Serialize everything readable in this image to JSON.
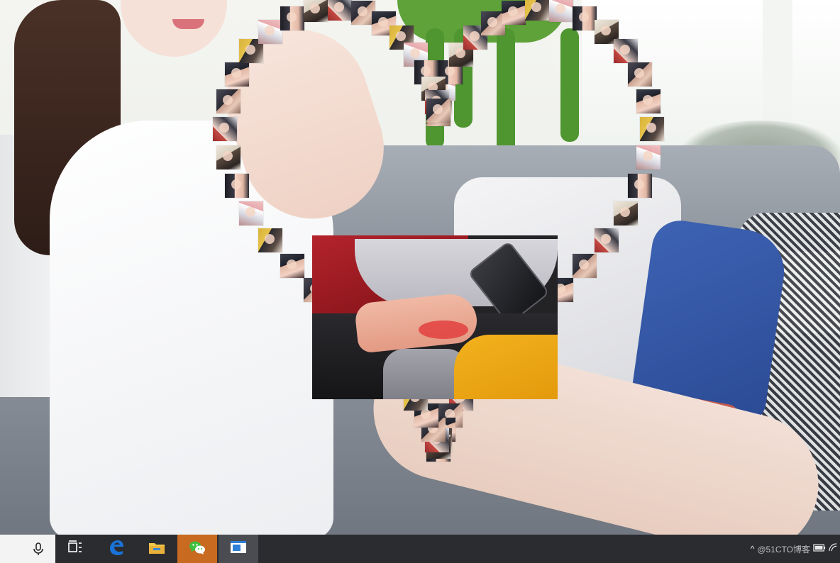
{
  "wallpaper": {
    "subject": "woman-on-sofa"
  },
  "heart": {
    "thumbnail_count": 64,
    "shape": "heart"
  },
  "center_photo": {
    "subject": "clasped-hands-photo"
  },
  "taskbar": {
    "search_icon": "microphone-icon",
    "items": [
      {
        "name": "task-view-button",
        "icon": "task-view-icon",
        "state": "normal"
      },
      {
        "name": "edge-button",
        "icon": "edge-icon",
        "state": "normal"
      },
      {
        "name": "file-explorer-button",
        "icon": "folder-icon",
        "state": "normal"
      },
      {
        "name": "wechat-button",
        "icon": "wechat-icon",
        "state": "active"
      },
      {
        "name": "app-window-button",
        "icon": "window-icon",
        "state": "running"
      }
    ],
    "tray": {
      "chevron": "^",
      "watermark": "@51CTO博客"
    }
  },
  "colors": {
    "taskbar_bg": "#2b2c30",
    "active_app": "#c86a1f",
    "running_app": "#4a4c52",
    "edge_blue": "#1a73d9",
    "wechat_green": "#3fbf3f"
  }
}
